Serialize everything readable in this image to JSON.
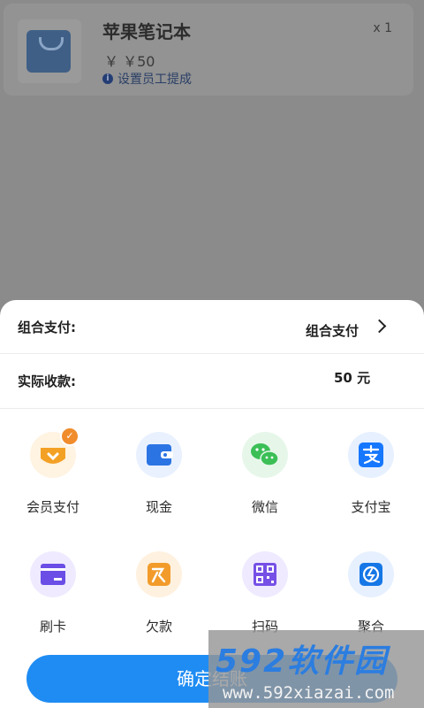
{
  "product": {
    "name": "苹果笔记本",
    "quantity": "x 1",
    "price": "￥ ￥50",
    "commission_link": "设置员工提成"
  },
  "sheet": {
    "combo_label": "组合支付:",
    "combo_value": "组合支付",
    "actual_label": "实际收款:",
    "actual_value": "50 元"
  },
  "payment_methods": [
    {
      "label": "会员支付",
      "icon": "vip-icon",
      "selected": true,
      "color": "#f3a125",
      "bg": "#fff3e1"
    },
    {
      "label": "现金",
      "icon": "wallet-icon",
      "selected": false,
      "color": "#2b74e4",
      "bg": "#e9f1ff"
    },
    {
      "label": "微信",
      "icon": "wechat-icon",
      "selected": false,
      "color": "#3bbf56",
      "bg": "#e6f7ea"
    },
    {
      "label": "支付宝",
      "icon": "alipay-icon",
      "selected": false,
      "color": "#1677ff",
      "bg": "#e6f0ff"
    },
    {
      "label": "刷卡",
      "icon": "card-icon",
      "selected": false,
      "color": "#6a4ee6",
      "bg": "#efeaff"
    },
    {
      "label": "欠款",
      "icon": "debt-icon",
      "selected": false,
      "color": "#f29b2b",
      "bg": "#fff1df"
    },
    {
      "label": "扫码",
      "icon": "qr-icon",
      "selected": false,
      "color": "#7650e6",
      "bg": "#efeaff"
    },
    {
      "label": "聚合",
      "icon": "aggregate-icon",
      "selected": false,
      "color": "#1677e6",
      "bg": "#e6f0ff"
    }
  ],
  "confirm_label": "确定结账",
  "watermark": {
    "top": "592软件园",
    "bottom": "www.592xiazai.com"
  }
}
